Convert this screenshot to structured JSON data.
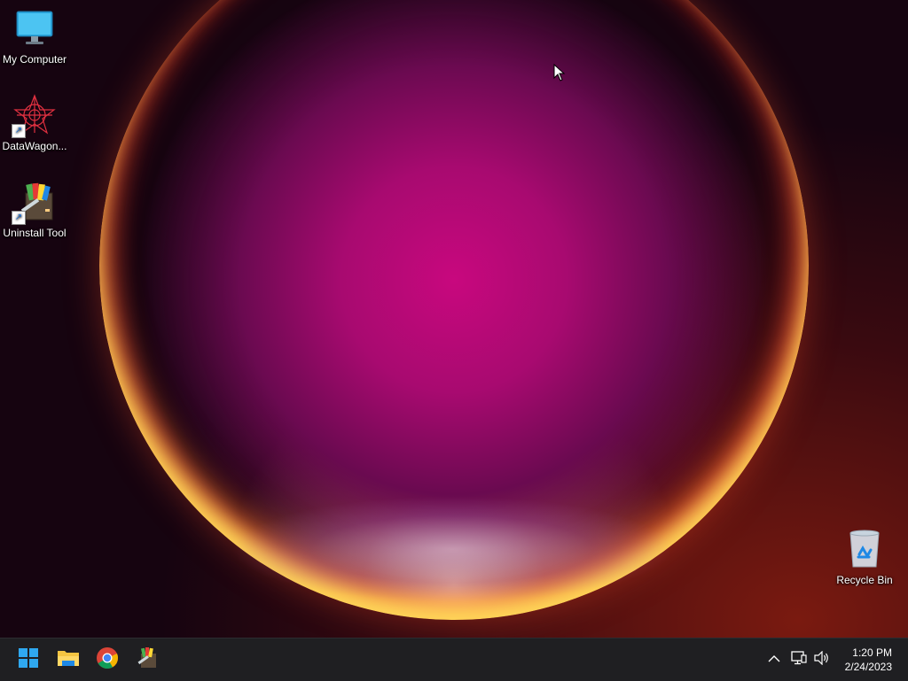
{
  "desktop": {
    "icons": [
      {
        "label": "My Computer",
        "icon": "monitor-icon"
      },
      {
        "label": "DataWagon...",
        "icon": "datawagon-icon",
        "shortcut": true
      },
      {
        "label": "Uninstall Tool",
        "icon": "uninstall-tool-icon",
        "shortcut": true
      },
      {
        "label": "Recycle Bin",
        "icon": "recycle-bin-icon"
      }
    ]
  },
  "taskbar": {
    "pinned": [
      {
        "name": "Start",
        "icon": "windows-start-icon"
      },
      {
        "name": "File Explorer",
        "icon": "folder-icon"
      },
      {
        "name": "Google Chrome",
        "icon": "chrome-icon"
      },
      {
        "name": "Uninstall Tool",
        "icon": "uninstall-tool-icon"
      }
    ],
    "tray": {
      "icons": [
        "chevron-up-icon",
        "network-icon",
        "volume-icon"
      ],
      "time": "1:20 PM",
      "date": "2/24/2023"
    }
  },
  "colors": {
    "accent": "#0a84ff",
    "taskbar": "#1f1f22",
    "orb_core": "#c8087e"
  }
}
